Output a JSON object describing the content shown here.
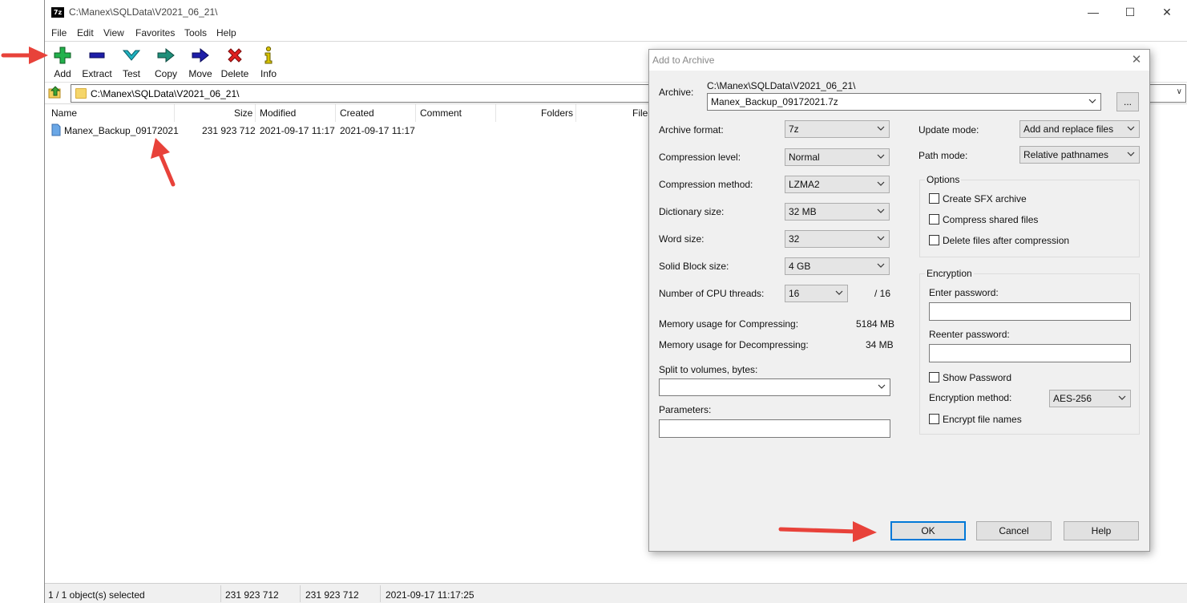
{
  "window": {
    "title": "C:\\Manex\\SQLData\\V2021_06_21\\",
    "app_icon": "7z",
    "controls": [
      "minimize-icon",
      "maximize-icon",
      "close-icon"
    ]
  },
  "menu": [
    "File",
    "Edit",
    "View",
    "Favorites",
    "Tools",
    "Help"
  ],
  "toolbar": [
    {
      "label": "Add",
      "icon": "add-icon",
      "color": "#22b14c"
    },
    {
      "label": "Extract",
      "icon": "extract-icon",
      "color": "#1e1ea8"
    },
    {
      "label": "Test",
      "icon": "test-icon",
      "color": "#20b2c0"
    },
    {
      "label": "Copy",
      "icon": "copy-icon",
      "color": "#1f8f7a"
    },
    {
      "label": "Move",
      "icon": "move-icon",
      "color": "#1e1ea8"
    },
    {
      "label": "Delete",
      "icon": "delete-icon",
      "color": "#e02020"
    },
    {
      "label": "Info",
      "icon": "info-icon",
      "color": "#d6c200"
    }
  ],
  "address": {
    "path": "C:\\Manex\\SQLData\\V2021_06_21\\"
  },
  "file_list": {
    "columns": [
      "Name",
      "Size",
      "Modified",
      "Created",
      "Comment",
      "Folders",
      "Files"
    ],
    "rows": [
      {
        "name": "Manex_Backup_09172021",
        "size": "231 923 712",
        "modified": "2021-09-17 11:17",
        "created": "2021-09-17 11:17"
      }
    ]
  },
  "status": {
    "selected": "1 / 1 object(s) selected",
    "size1": "231 923 712",
    "size2": "231 923 712",
    "datetime": "2021-09-17 11:17:25"
  },
  "dialog": {
    "title": "Add to Archive",
    "archive_label": "Archive:",
    "archive_dir": "C:\\Manex\\SQLData\\V2021_06_21\\",
    "archive_name": "Manex_Backup_09172021.7z",
    "browse_label": "...",
    "left": [
      {
        "label": "Archive format:",
        "value": "7z"
      },
      {
        "label": "Compression level:",
        "value": "Normal"
      },
      {
        "label": "Compression method:",
        "value": "LZMA2"
      },
      {
        "label": "Dictionary size:",
        "value": "32 MB"
      },
      {
        "label": "Word size:",
        "value": "32"
      },
      {
        "label": "Solid Block size:",
        "value": "4 GB"
      }
    ],
    "cpu_label": "Number of CPU threads:",
    "cpu_value": "16",
    "cpu_total": "/ 16",
    "mem_compress_label": "Memory usage for Compressing:",
    "mem_compress_value": "5184 MB",
    "mem_decompress_label": "Memory usage for Decompressing:",
    "mem_decompress_value": "34 MB",
    "split_label": "Split to volumes, bytes:",
    "split_value": "",
    "params_label": "Parameters:",
    "params_value": "",
    "update_mode_label": "Update mode:",
    "update_mode_value": "Add and replace files",
    "path_mode_label": "Path mode:",
    "path_mode_value": "Relative pathnames",
    "options_title": "Options",
    "options": [
      {
        "label": "Create SFX archive",
        "checked": false
      },
      {
        "label": "Compress shared files",
        "checked": false
      },
      {
        "label": "Delete files after compression",
        "checked": false
      }
    ],
    "encryption_title": "Encryption",
    "enter_password_label": "Enter password:",
    "reenter_password_label": "Reenter password:",
    "show_password_label": "Show Password",
    "enc_method_label": "Encryption method:",
    "enc_method_value": "AES-256",
    "encrypt_names_label": "Encrypt file names",
    "buttons": {
      "ok": "OK",
      "cancel": "Cancel",
      "help": "Help"
    }
  },
  "annotations": {
    "arrow_color": "#e8423a"
  }
}
